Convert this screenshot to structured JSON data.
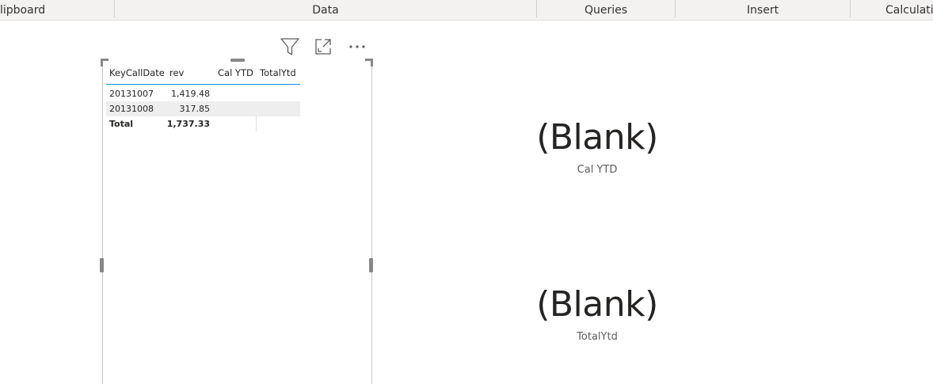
{
  "ribbon": {
    "groups": [
      "lipboard",
      "Data",
      "Queries",
      "Insert",
      "Calculatio"
    ]
  },
  "visual_header": {
    "icons": [
      "filter-icon",
      "focus-mode-icon",
      "more-options-icon"
    ]
  },
  "table": {
    "columns": [
      "KeyCallDate",
      "rev",
      "Cal YTD",
      "TotalYtd"
    ],
    "rows": [
      {
        "key": "20131007",
        "rev": "1,419.48",
        "cal_ytd": "",
        "total_ytd": ""
      },
      {
        "key": "20131008",
        "rev": "317.85",
        "cal_ytd": "",
        "total_ytd": ""
      }
    ],
    "total": {
      "label": "Total",
      "rev": "1,737.33"
    }
  },
  "cards": [
    {
      "value": "(Blank)",
      "label": "Cal YTD"
    },
    {
      "value": "(Blank)",
      "label": "TotalYtd"
    }
  ],
  "colors": {
    "accent": "#118dff",
    "ribbon_bg": "#f3f2f1",
    "row_shade": "#eeeeee"
  }
}
